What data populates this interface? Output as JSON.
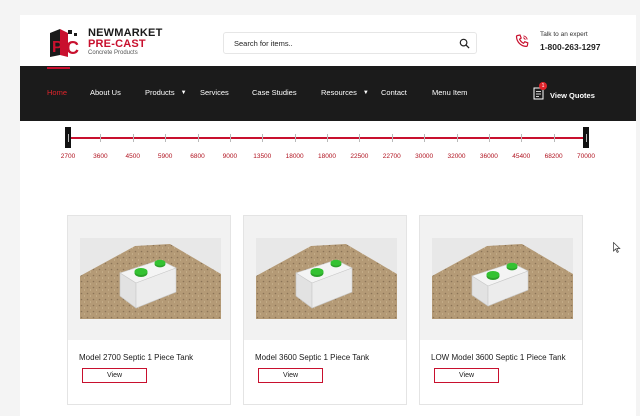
{
  "brand": {
    "line1": "NEWMARKET",
    "line2": "PRE-CAST",
    "tagline": "Concrete Products"
  },
  "search": {
    "placeholder": "Search for items.."
  },
  "contact": {
    "label": "Talk to an expert",
    "phone": "1-800-263-1297"
  },
  "nav": {
    "items": [
      {
        "label": "Home",
        "active": true
      },
      {
        "label": "About Us"
      },
      {
        "label": "Products",
        "dropdown": true
      },
      {
        "label": "Services"
      },
      {
        "label": "Case Studies"
      },
      {
        "label": "Resources",
        "dropdown": true
      },
      {
        "label": "Contact"
      },
      {
        "label": "Menu Item"
      }
    ],
    "quotes_label": "View Quotes",
    "quotes_count": "1"
  },
  "capacity_slider": {
    "ticks": [
      "2700",
      "3600",
      "4500",
      "5900",
      "6800",
      "9000",
      "13500",
      "18000",
      "18000",
      "22500",
      "22700",
      "30000",
      "32000",
      "36000",
      "45400",
      "68200",
      "70000"
    ],
    "selected_min": "2700",
    "selected_max": "70000"
  },
  "products": [
    {
      "title": "Model 2700 Septic 1 Piece Tank",
      "button": "View"
    },
    {
      "title": "Model 3600 Septic 1 Piece Tank",
      "button": "View"
    },
    {
      "title": "LOW Model 3600 Septic 1 Piece Tank",
      "button": "View"
    }
  ],
  "colors": {
    "accent": "#c8102e",
    "navbar": "#1b1b1b",
    "nav_active": "#e0242b"
  }
}
